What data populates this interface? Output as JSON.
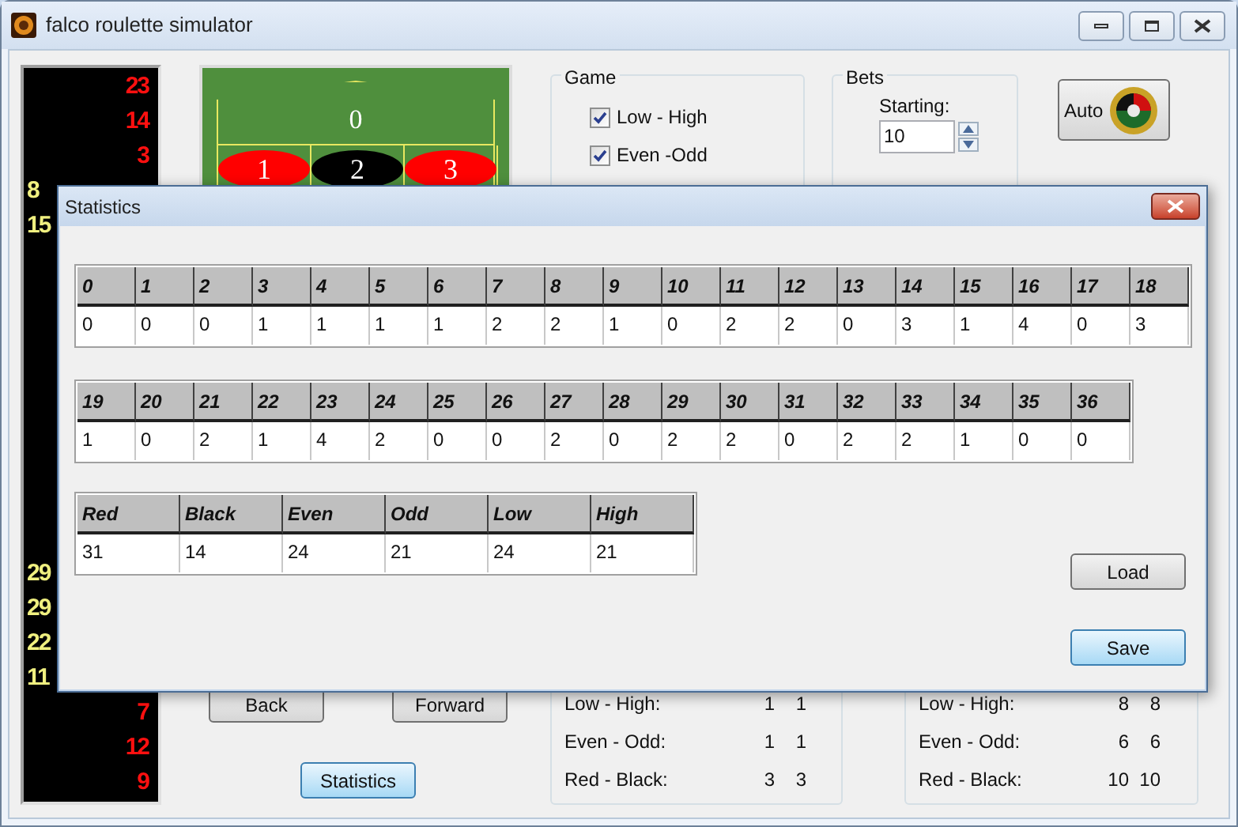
{
  "window": {
    "title": "falco roulette simulator"
  },
  "history_top": [
    {
      "number": "23",
      "kind": "red"
    },
    {
      "number": "14",
      "kind": "red"
    },
    {
      "number": "3",
      "kind": "red"
    },
    {
      "number": "8",
      "kind": "black"
    },
    {
      "number": "15",
      "kind": "black"
    }
  ],
  "history_bottom": [
    {
      "number": "29",
      "kind": "black"
    },
    {
      "number": "29",
      "kind": "black"
    },
    {
      "number": "22",
      "kind": "black"
    },
    {
      "number": "11",
      "kind": "black"
    },
    {
      "number": "7",
      "kind": "red"
    },
    {
      "number": "12",
      "kind": "red"
    },
    {
      "number": "9",
      "kind": "red"
    }
  ],
  "table": {
    "zero": "0",
    "numbers": [
      {
        "number": "1",
        "kind": "red"
      },
      {
        "number": "2",
        "kind": "black"
      },
      {
        "number": "3",
        "kind": "red"
      }
    ]
  },
  "game": {
    "title": "Game",
    "options": [
      {
        "label": "Low - High",
        "checked": true
      },
      {
        "label": "Even -Odd",
        "checked": true
      }
    ]
  },
  "bets": {
    "title": "Bets",
    "starting_label": "Starting:",
    "starting_value": "10"
  },
  "auto_button": "Auto",
  "nav_buttons": [
    "Back",
    "Forward"
  ],
  "statistics_button": {
    "label": "Statistics",
    "focused": true
  },
  "stats_left": [
    {
      "label": "Low - High:",
      "values": [
        "1",
        "1"
      ]
    },
    {
      "label": "Even - Odd:",
      "values": [
        "1",
        "1"
      ]
    },
    {
      "label": "Red - Black:",
      "values": [
        "3",
        "3"
      ]
    }
  ],
  "stats_right": [
    {
      "label": "Low - High:",
      "values": [
        "8",
        "8"
      ]
    },
    {
      "label": "Even - Odd:",
      "values": [
        "6",
        "6"
      ]
    },
    {
      "label": "Red - Black:",
      "values": [
        "10",
        "10"
      ]
    }
  ],
  "dialog": {
    "title": "Statistics",
    "number_tables": [
      {
        "columns": [
          "0",
          "1",
          "2",
          "3",
          "4",
          "5",
          "6",
          "7",
          "8",
          "9",
          "10",
          "11",
          "12",
          "13",
          "14",
          "15",
          "16",
          "17",
          "18"
        ],
        "values": [
          "0",
          "0",
          "0",
          "1",
          "1",
          "1",
          "1",
          "2",
          "2",
          "1",
          "0",
          "2",
          "2",
          "0",
          "3",
          "1",
          "4",
          "0",
          "3"
        ]
      },
      {
        "columns": [
          "19",
          "20",
          "21",
          "22",
          "23",
          "24",
          "25",
          "26",
          "27",
          "28",
          "29",
          "30",
          "31",
          "32",
          "33",
          "34",
          "35",
          "36"
        ],
        "values": [
          "1",
          "0",
          "2",
          "1",
          "4",
          "2",
          "0",
          "0",
          "2",
          "0",
          "2",
          "2",
          "0",
          "2",
          "2",
          "1",
          "0",
          "0"
        ]
      }
    ],
    "summary_table": {
      "columns": [
        "Red",
        "Black",
        "Even",
        "Odd",
        "Low",
        "High"
      ],
      "values": [
        "31",
        "14",
        "24",
        "21",
        "24",
        "21"
      ]
    },
    "buttons": [
      {
        "label": "Load",
        "focused": false
      },
      {
        "label": "Save",
        "focused": true
      }
    ]
  }
}
